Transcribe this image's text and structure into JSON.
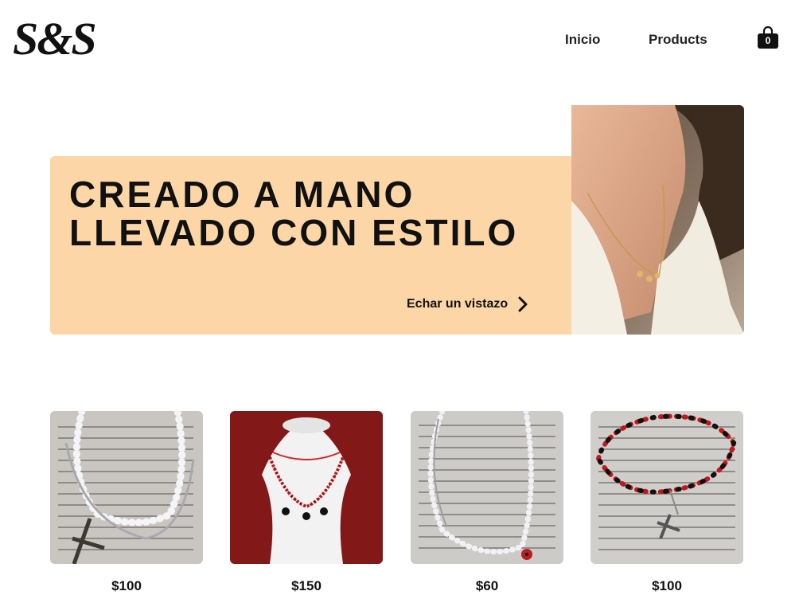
{
  "header": {
    "logo": "S&S",
    "nav": [
      {
        "label": "Inicio"
      },
      {
        "label": "Products"
      }
    ],
    "cart_count": "0"
  },
  "hero": {
    "title_line1": "CREADO A MANO",
    "title_line2": "LLEVADO CON ESTILO",
    "cta_label": "Echar un vistazo",
    "background_color": "#fdd6a8"
  },
  "products": [
    {
      "price": "$100"
    },
    {
      "price": "$150"
    },
    {
      "price": "$60"
    },
    {
      "price": "$100"
    }
  ]
}
